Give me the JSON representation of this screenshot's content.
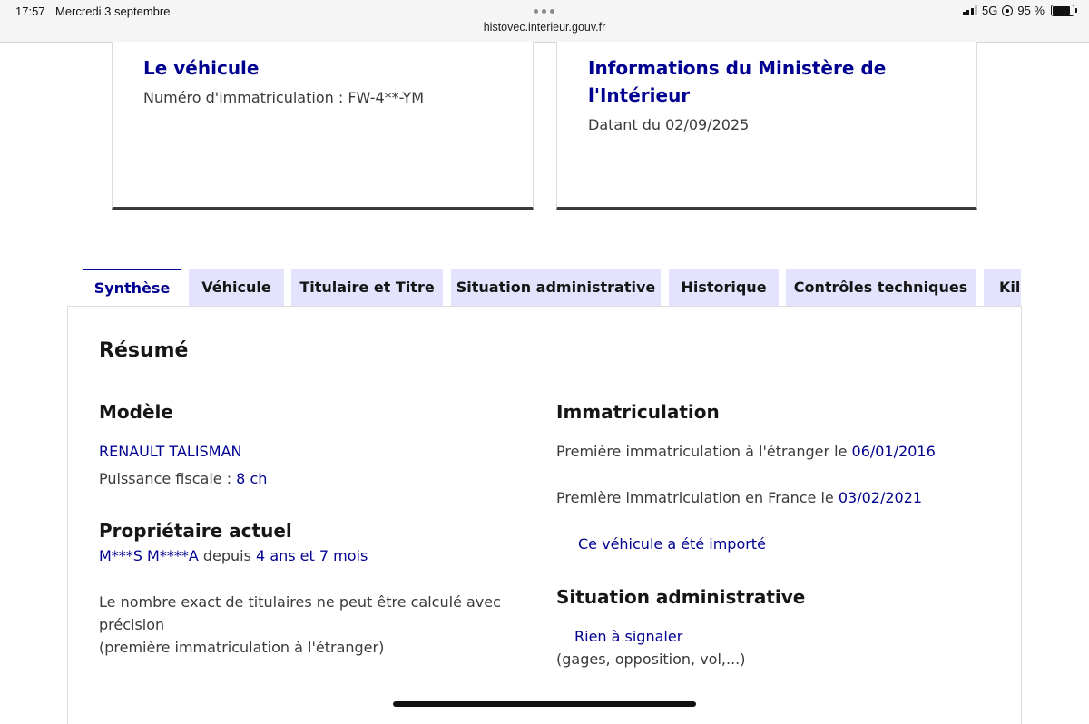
{
  "status_bar": {
    "time": "17:57",
    "date": "Mercredi 3 septembre",
    "url": "histovec.interieur.gouv.fr",
    "network": "5G",
    "battery": "95 %",
    "battery_level": 0.95
  },
  "cards": {
    "vehicle": {
      "title": "Le véhicule",
      "text": "Numéro d'immatriculation : FW-4**-YM"
    },
    "ministry": {
      "title": "Informations du Ministère de l'Intérieur",
      "text": "Datant du 02/09/2025"
    }
  },
  "tabs": [
    {
      "label": "Synthèse",
      "active": true
    },
    {
      "label": "Véhicule",
      "active": false
    },
    {
      "label": "Titulaire et Titre",
      "active": false
    },
    {
      "label": "Situation administrative",
      "active": false
    },
    {
      "label": "Historique",
      "active": false
    },
    {
      "label": "Contrôles techniques",
      "active": false
    },
    {
      "label": "Kilométrage",
      "active": false
    }
  ],
  "resume": {
    "title": "Résumé",
    "modele": {
      "heading": "Modèle",
      "name": "RENAULT TALISMAN",
      "puissance_label": "Puissance fiscale : ",
      "puissance_value": "8 ch"
    },
    "proprietaire": {
      "heading": "Propriétaire actuel",
      "name": "M***S M****A",
      "since_label": " depuis ",
      "since_value": "4 ans et 7 mois",
      "note_line1": "Le nombre exact de titulaires ne peut être calculé avec",
      "note_line2": "précision",
      "note_line3": "(première immatriculation à l'étranger)"
    },
    "immatriculation": {
      "heading": "Immatriculation",
      "foreign_label": "Première immatriculation à l'étranger le ",
      "foreign_date": "06/01/2016",
      "france_label": "Première immatriculation en France le ",
      "france_date": "03/02/2021",
      "import_link": "Ce véhicule a été importé"
    },
    "situation": {
      "heading": "Situation administrative",
      "status_link": "Rien à signaler",
      "detail": "(gages, opposition, vol,...)"
    }
  }
}
